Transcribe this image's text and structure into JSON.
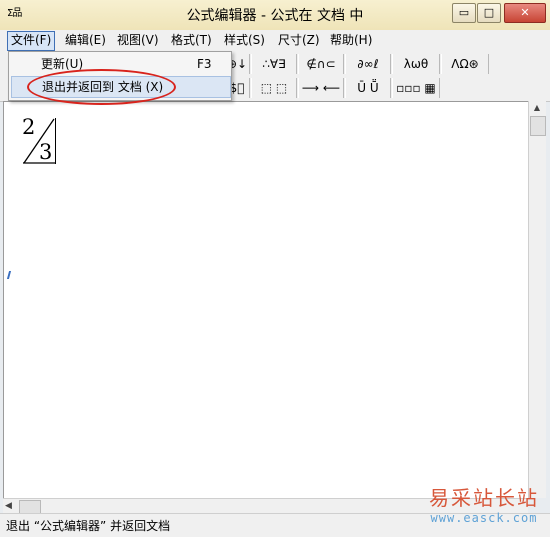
{
  "window": {
    "title": "公式编辑器 - 公式在 文档  中",
    "app_icon": "Σ品",
    "buttons": {
      "minimize": "▭",
      "maximize": "□",
      "close": "✕"
    }
  },
  "menu": [
    {
      "label": "文件(F)"
    },
    {
      "label": "编辑(E)"
    },
    {
      "label": "视图(V)"
    },
    {
      "label": "格式(T)"
    },
    {
      "label": "样式(S)"
    },
    {
      "label": "尺寸(Z)"
    },
    {
      "label": "帮助(H)"
    }
  ],
  "file_menu": [
    {
      "label": "更新(U)",
      "shortcut": "F3"
    },
    {
      "label": "退出并返回到 文档 (X)",
      "shortcut": ""
    }
  ],
  "toolbar": {
    "row1": [
      "⊕↓",
      "∴∀∃",
      "∉∩⊂",
      "∂∞ℓ",
      "λωθ",
      "ΛΩ⊛"
    ],
    "row2": [
      "$⃞",
      "⬚ ⬚",
      "⟶ ⟵",
      "Ū Ṻ",
      "▫▫▫ ▦"
    ]
  },
  "editor": {
    "numerator": "2",
    "denominator": "3"
  },
  "status": {
    "text": "退出 “公式编辑器” 并返回文档"
  },
  "watermark": {
    "line1": "易采站长站",
    "line2": "www.easck.com"
  }
}
